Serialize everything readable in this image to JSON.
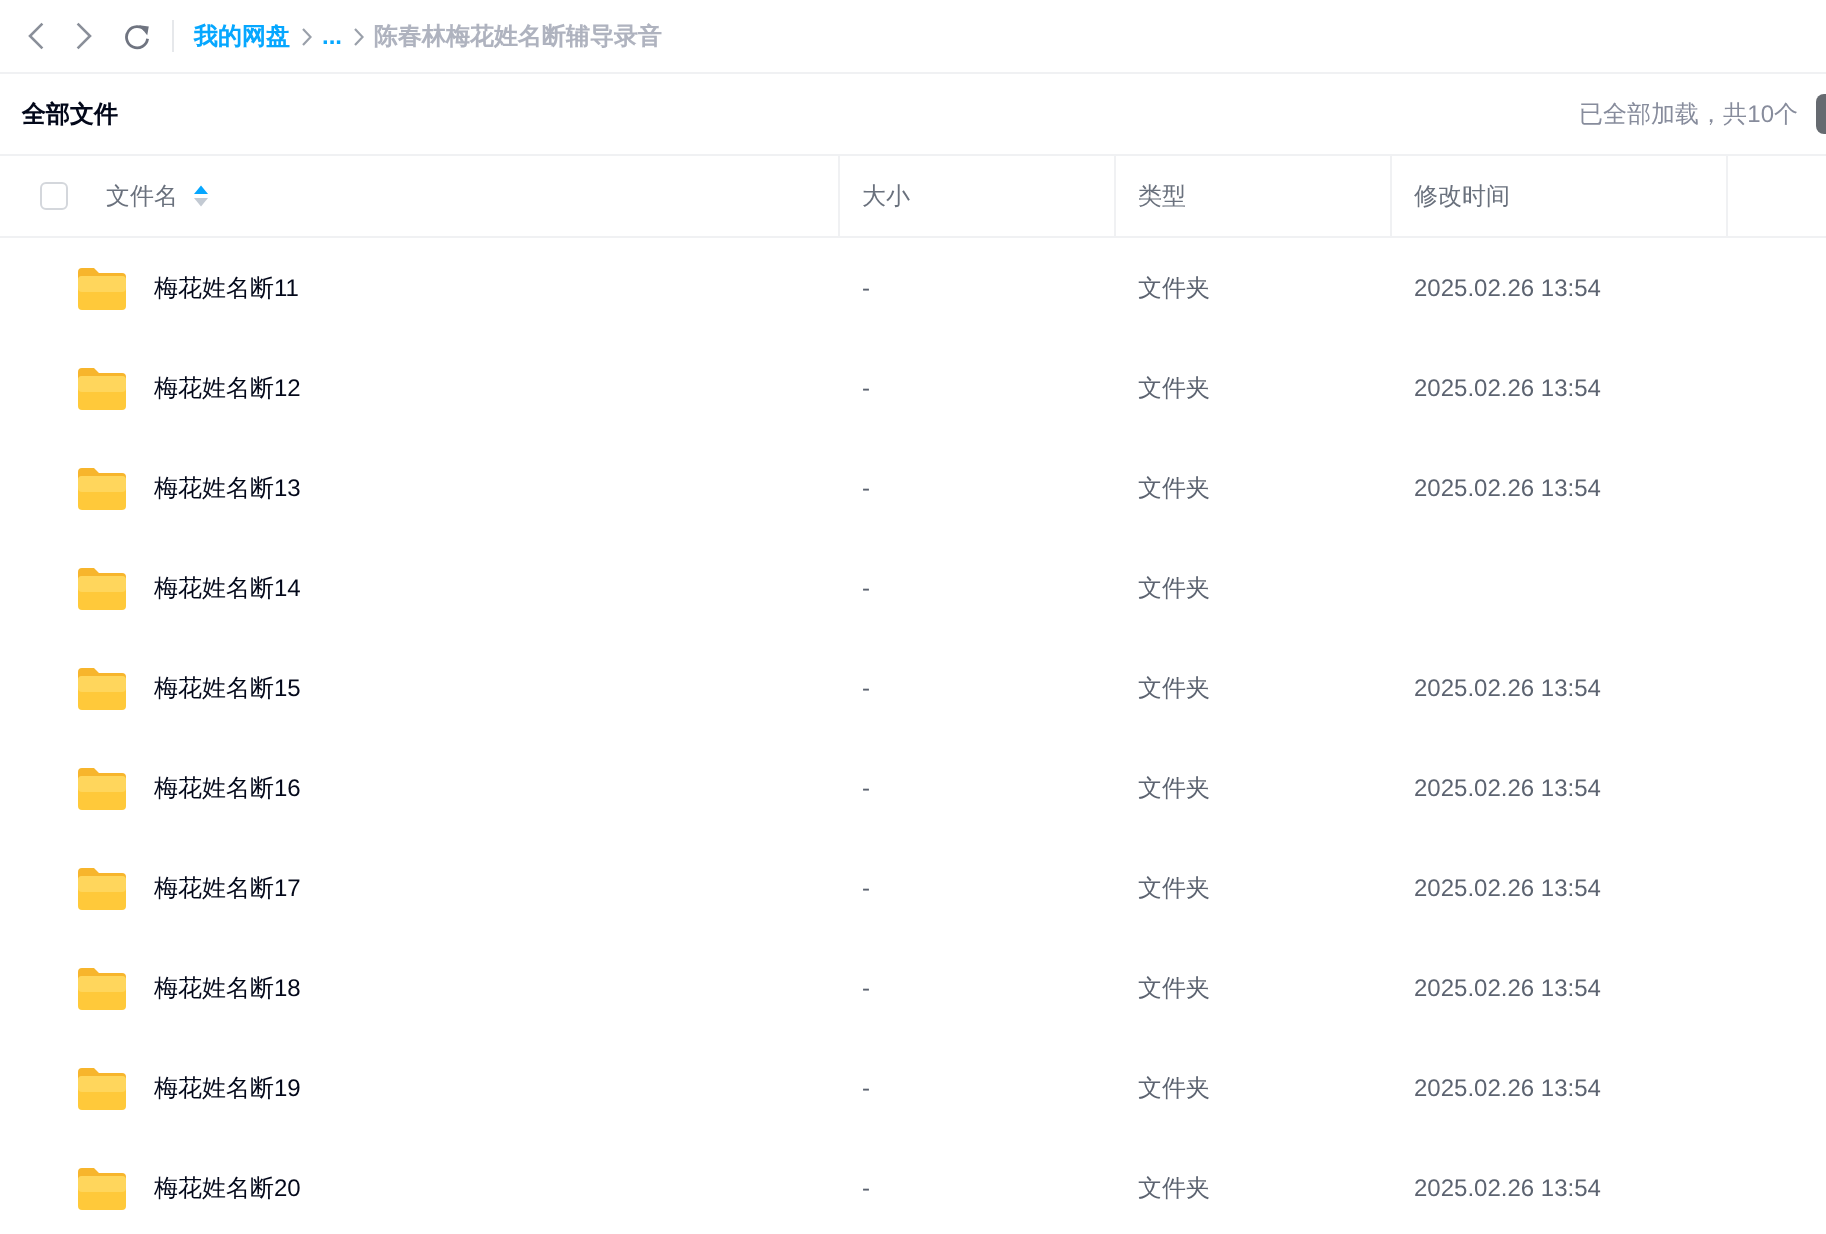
{
  "nav": {
    "breadcrumb": [
      {
        "label": "我的网盘",
        "kind": "link"
      },
      {
        "label": "...",
        "kind": "link"
      },
      {
        "label": "陈春林梅花姓名断辅导录音",
        "kind": "current"
      }
    ]
  },
  "toolbar": {
    "title": "全部文件",
    "status": "已全部加载，共10个"
  },
  "table": {
    "select_all": {
      "checked": false
    },
    "columns": [
      {
        "label": "文件名",
        "sorted": true
      },
      {
        "label": "大小",
        "sorted": false
      },
      {
        "label": "类型",
        "sorted": false
      },
      {
        "label": "修改时间",
        "sorted": false
      }
    ],
    "rows": [
      {
        "name": "梅花姓名断11",
        "size": "-",
        "type": "文件夹",
        "modified": "2025.02.26 13:54"
      },
      {
        "name": "梅花姓名断12",
        "size": "-",
        "type": "文件夹",
        "modified": "2025.02.26 13:54"
      },
      {
        "name": "梅花姓名断13",
        "size": "-",
        "type": "文件夹",
        "modified": "2025.02.26 13:54"
      },
      {
        "name": "梅花姓名断14",
        "size": "-",
        "type": "文件夹"
      },
      {
        "name": "梅花姓名断15",
        "size": "-",
        "type": "文件夹",
        "modified": "2025.02.26 13:54"
      },
      {
        "name": "梅花姓名断16",
        "size": "-",
        "type": "文件夹",
        "modified": "2025.02.26 13:54"
      },
      {
        "name": "梅花姓名断17",
        "size": "-",
        "type": "文件夹",
        "modified": "2025.02.26 13:54"
      },
      {
        "name": "梅花姓名断18",
        "size": "-",
        "type": "文件夹",
        "modified": "2025.02.26 13:54"
      },
      {
        "name": "梅花姓名断19",
        "size": "-",
        "type": "文件夹",
        "modified": "2025.02.26 13:54"
      },
      {
        "name": "梅花姓名断20",
        "size": "-",
        "type": "文件夹",
        "modified": "2025.02.26 13:54"
      }
    ]
  }
}
